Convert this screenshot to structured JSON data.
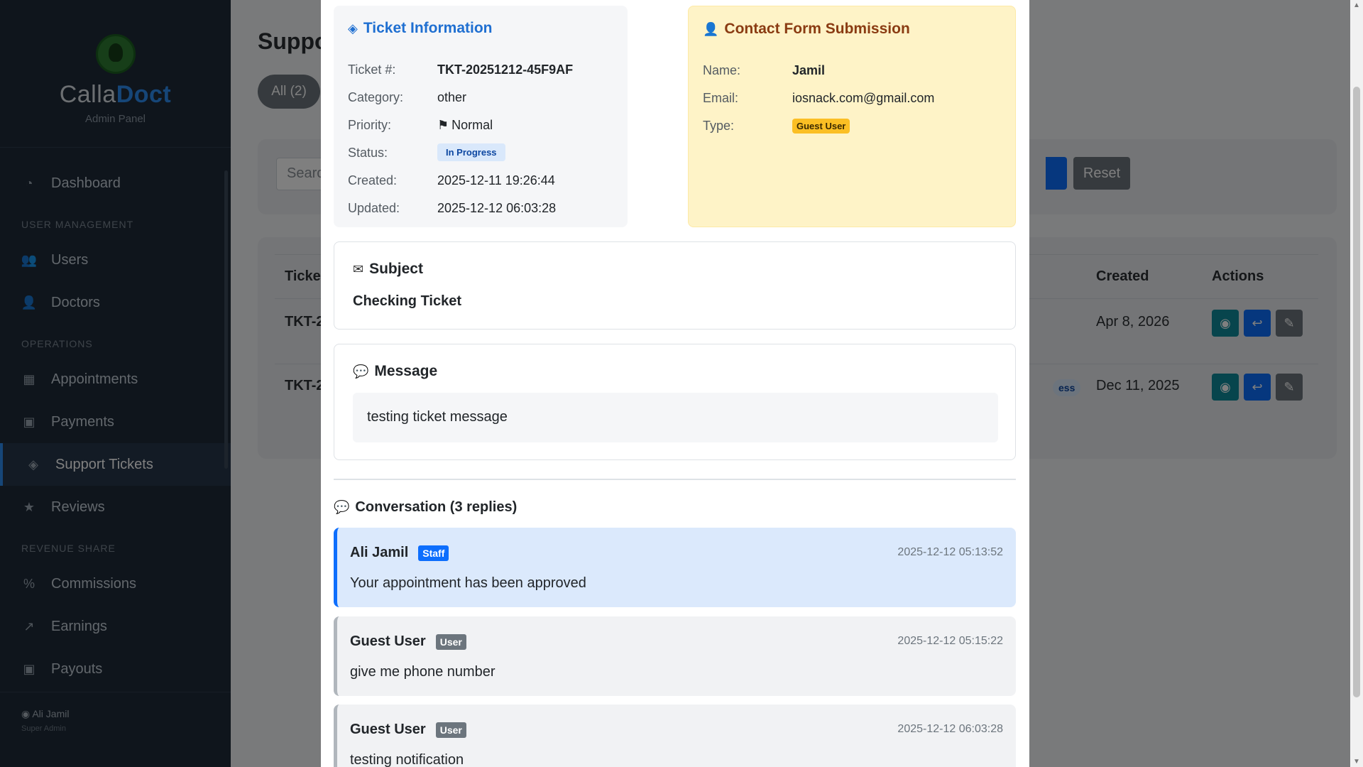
{
  "sidebar": {
    "brand": {
      "name_a": "Calla",
      "name_b": "Doct",
      "subtitle": "Admin Panel"
    },
    "items": [
      {
        "label": "Dashboard",
        "icon": "gauge-icon"
      },
      {
        "section": "USER MANAGEMENT"
      },
      {
        "label": "Users",
        "icon": "users-icon"
      },
      {
        "label": "Doctors",
        "icon": "doctor-icon"
      },
      {
        "section": "OPERATIONS"
      },
      {
        "label": "Appointments",
        "icon": "calendar-icon"
      },
      {
        "label": "Payments",
        "icon": "money-icon"
      },
      {
        "label": "Support Tickets",
        "icon": "ticket-icon",
        "active": true
      },
      {
        "label": "Reviews",
        "icon": "star-icon"
      },
      {
        "section": "REVENUE SHARE"
      },
      {
        "label": "Commissions",
        "icon": "percent-icon"
      },
      {
        "label": "Earnings",
        "icon": "chart-line-icon"
      },
      {
        "label": "Payouts",
        "icon": "money-icon"
      }
    ],
    "footer": {
      "name": "Ali Jamil",
      "role": "Super Admin"
    }
  },
  "background": {
    "page_title": "Suppo",
    "filter_all": "All (2)",
    "search_placeholder": "Searc",
    "reset_label": "Reset",
    "table": {
      "headers": {
        "ticket": "Ticke",
        "created": "Created",
        "actions": "Actions"
      },
      "rows": [
        {
          "ticket": "TKT-2",
          "status": "",
          "created": "Apr 8, 2026"
        },
        {
          "ticket": "TKT-2",
          "status": "ess",
          "created": "Dec 11, 2025"
        }
      ]
    }
  },
  "modal": {
    "ticket_info": {
      "title": "Ticket Information",
      "fields": [
        {
          "key": "Ticket #:",
          "value": "TKT-20251212-45F9AF"
        },
        {
          "key": "Category:",
          "value": "other"
        },
        {
          "key": "Priority:",
          "value": "Normal"
        },
        {
          "key": "Status:",
          "value": "In Progress"
        },
        {
          "key": "Created:",
          "value": "2025-12-11 19:26:44"
        },
        {
          "key": "Updated:",
          "value": "2025-12-12 06:03:28"
        }
      ]
    },
    "contact": {
      "title": "Contact Form Submission",
      "fields": [
        {
          "key": "Name:",
          "value": "Jamil"
        },
        {
          "key": "Email:",
          "value": "iosnack.com@gmail.com"
        },
        {
          "key": "Type:",
          "value": "Guest User"
        }
      ]
    },
    "subject": {
      "title": "Subject",
      "text": "Checking Ticket"
    },
    "message": {
      "title": "Message",
      "text": "testing ticket message"
    },
    "conversation": {
      "title": "Conversation (3 replies)",
      "replies": [
        {
          "author": "Ali Jamil",
          "tag": "Staff",
          "time": "2025-12-12 05:13:52",
          "text": "Your appointment has been approved"
        },
        {
          "author": "Guest User",
          "tag": "User",
          "time": "2025-12-12 05:15:22",
          "text": "give me phone number"
        },
        {
          "author": "Guest User",
          "tag": "User",
          "time": "2025-12-12 06:03:28",
          "text": "testing notification"
        }
      ]
    }
  },
  "colors": {
    "primary": "#0d6efd",
    "sidebar_bg": "#1f2b38",
    "contact_bg": "#fef3c7",
    "ticket_title": "#1f6fd1",
    "contact_title": "#8a3b12"
  }
}
